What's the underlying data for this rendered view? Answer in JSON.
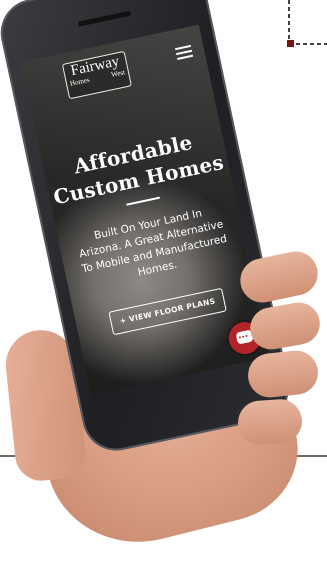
{
  "site": {
    "logo_top": "Fairway",
    "logo_left": "Homes",
    "logo_right": "West"
  },
  "hero": {
    "headline": "Affordable Custom Homes",
    "subtext": "Built On Your Land In Arizona. A Great Alternative To Mobile and Manufactured Homes.",
    "cta_label": "+ VIEW FLOOR PLANS"
  },
  "icons": {
    "menu": "hamburger-menu-icon",
    "chat": "chat-bubble-icon"
  },
  "colors": {
    "chat_button": "#b3232a",
    "corner_mark": "#7a1212"
  }
}
